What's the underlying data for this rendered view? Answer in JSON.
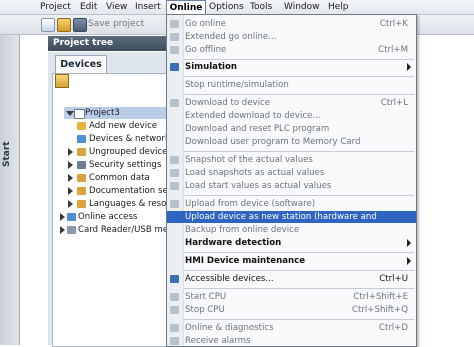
{
  "menubar": {
    "items": [
      "Project",
      "Edit",
      "View",
      "Insert",
      "Online",
      "Options",
      "Tools",
      "Window",
      "Help"
    ]
  },
  "toolbar": {
    "save_label": "Save project"
  },
  "sidebar": {
    "start_label": "Start"
  },
  "project_tree": {
    "title": "Project tree",
    "tab": "Devices",
    "items": [
      {
        "label": "Project3"
      },
      {
        "label": "Add new device"
      },
      {
        "label": "Devices & networks"
      },
      {
        "label": "Ungrouped devices"
      },
      {
        "label": "Security settings"
      },
      {
        "label": "Common data"
      },
      {
        "label": "Documentation settings"
      },
      {
        "label": "Languages & resources"
      },
      {
        "label": "Online access"
      },
      {
        "label": "Card Reader/USB memory"
      }
    ]
  },
  "online_menu": {
    "items": [
      {
        "label": "Go online",
        "shortcut": "Ctrl+K"
      },
      {
        "label": "Extended go online...",
        "shortcut": ""
      },
      {
        "label": "Go offline",
        "shortcut": "Ctrl+M"
      },
      {
        "label": "Simulation",
        "shortcut": ""
      },
      {
        "label": "Stop runtime/simulation",
        "shortcut": ""
      },
      {
        "label": "Download to device",
        "shortcut": "Ctrl+L"
      },
      {
        "label": "Extended download to device...",
        "shortcut": ""
      },
      {
        "label": "Download and reset PLC program",
        "shortcut": ""
      },
      {
        "label": "Download user program to Memory Card",
        "shortcut": ""
      },
      {
        "label": "Snapshot of the actual values",
        "shortcut": ""
      },
      {
        "label": "Load snapshots as actual values",
        "shortcut": ""
      },
      {
        "label": "Load start values as actual values",
        "shortcut": ""
      },
      {
        "label": "Upload from device (software)",
        "shortcut": ""
      },
      {
        "label": "Upload device as new station (hardware and software)...",
        "shortcut": ""
      },
      {
        "label": "Backup from online device",
        "shortcut": ""
      },
      {
        "label": "Hardware detection",
        "shortcut": ""
      },
      {
        "label": "HMI Device maintenance",
        "shortcut": ""
      },
      {
        "label": "Accessible devices...",
        "shortcut": "Ctrl+U"
      },
      {
        "label": "Start CPU",
        "shortcut": "Ctrl+Shift+E"
      },
      {
        "label": "Stop CPU",
        "shortcut": "Ctrl+Shift+Q"
      },
      {
        "label": "Online & diagnostics",
        "shortcut": "Ctrl+D"
      },
      {
        "label": "Receive alarms",
        "shortcut": ""
      }
    ]
  },
  "colors": {
    "menu_highlight": "#2f64c0",
    "tree_selection": "#b9cde8",
    "header_dark": "#3c4a59"
  }
}
